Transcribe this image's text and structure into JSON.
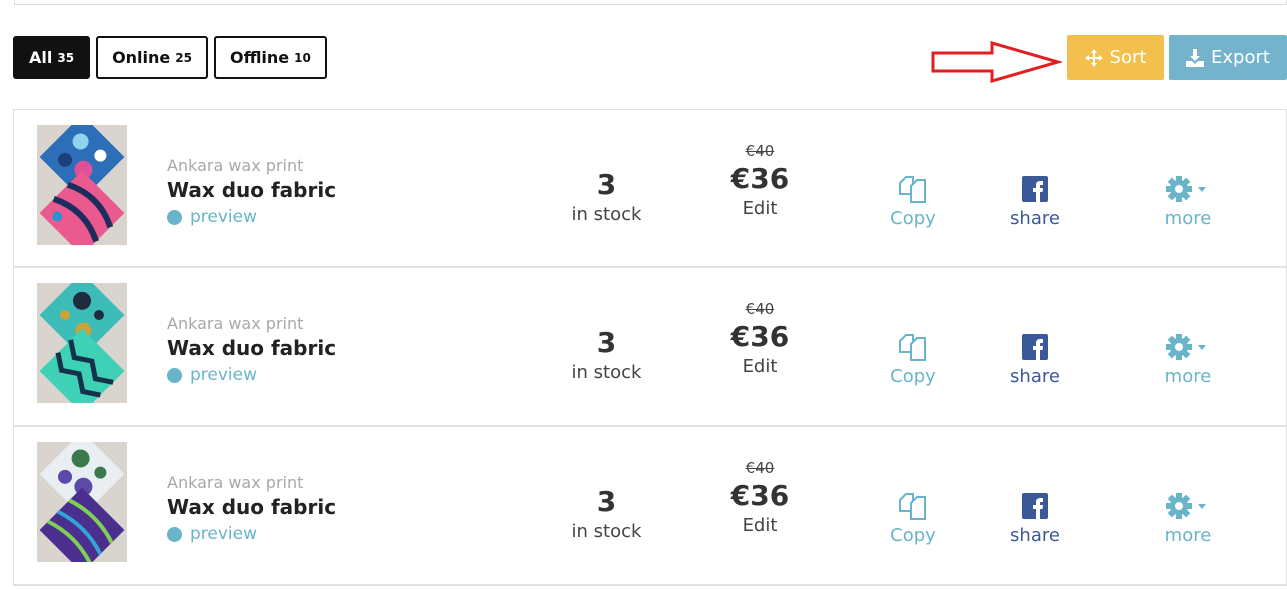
{
  "filters": [
    {
      "label": "All",
      "count": "35",
      "active": true
    },
    {
      "label": "Online",
      "count": "25",
      "active": false
    },
    {
      "label": "Offline",
      "count": "10",
      "active": false
    }
  ],
  "toolbar": {
    "sort_label": "Sort",
    "export_label": "Export"
  },
  "colors": {
    "sort": "#f3c04e",
    "export": "#74b3cc",
    "link": "#6ab4c9",
    "facebook": "#3b5998",
    "arrow": "#e02020"
  },
  "products": [
    {
      "category": "Ankara wax print",
      "name": "Wax duo fabric",
      "preview": "preview",
      "stock": "3",
      "stock_label": "in stock",
      "old_price": "€40",
      "price": "€36",
      "edit": "Edit",
      "copy": "Copy",
      "share": "share",
      "more": "more"
    },
    {
      "category": "Ankara wax print",
      "name": "Wax duo fabric",
      "preview": "preview",
      "stock": "3",
      "stock_label": "in stock",
      "old_price": "€40",
      "price": "€36",
      "edit": "Edit",
      "copy": "Copy",
      "share": "share",
      "more": "more"
    },
    {
      "category": "Ankara wax print",
      "name": "Wax duo fabric",
      "preview": "preview",
      "stock": "3",
      "stock_label": "in stock",
      "old_price": "€40",
      "price": "€36",
      "edit": "Edit",
      "copy": "Copy",
      "share": "share",
      "more": "more"
    }
  ]
}
